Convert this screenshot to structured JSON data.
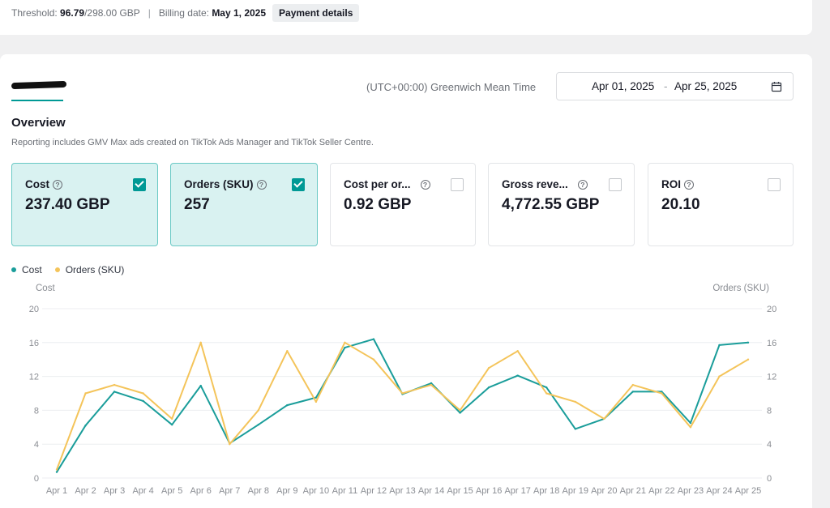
{
  "billing": {
    "threshold_label": "Threshold:",
    "threshold_used": "96.79",
    "threshold_total": "/298.00 GBP",
    "separator": "|",
    "billing_date_label": "Billing date:",
    "billing_date": "May 1, 2025",
    "payment_button": "Payment details"
  },
  "header": {
    "timezone": "(UTC+00:00) Greenwich Mean Time",
    "date_start": "Apr 01, 2025",
    "date_sep": "-",
    "date_end": "Apr 25, 2025"
  },
  "overview": {
    "title": "Overview",
    "subtitle": "Reporting includes GMV Max ads created on TikTok Ads Manager and TikTok Seller Centre."
  },
  "metrics": [
    {
      "label": "Cost",
      "value": "237.40 GBP",
      "selected": true
    },
    {
      "label": "Orders (SKU)",
      "value": "257",
      "selected": true
    },
    {
      "label": "Cost per or...",
      "value": "0.92 GBP",
      "selected": false
    },
    {
      "label": "Gross reve...",
      "value": "4,772.55 GBP",
      "selected": false
    },
    {
      "label": "ROI",
      "value": "20.10",
      "selected": false
    }
  ],
  "colors": {
    "accent": "#009995",
    "cost_line": "#1a9d9a",
    "orders_line": "#f4c45a",
    "selected_bg": "#d9f2f1"
  },
  "chart_data": {
    "type": "line",
    "categories": [
      "Apr 1",
      "Apr 2",
      "Apr 3",
      "Apr 4",
      "Apr 5",
      "Apr 6",
      "Apr 7",
      "Apr 8",
      "Apr 9",
      "Apr 10",
      "Apr 11",
      "Apr 12",
      "Apr 13",
      "Apr 14",
      "Apr 15",
      "Apr 16",
      "Apr 17",
      "Apr 18",
      "Apr 19",
      "Apr 20",
      "Apr 21",
      "Apr 22",
      "Apr 23",
      "Apr 24",
      "Apr 25"
    ],
    "series": [
      {
        "name": "Cost",
        "axis": "left",
        "color": "#1a9d9a",
        "values": [
          0.7,
          6.2,
          10.2,
          9.1,
          6.3,
          10.9,
          4.1,
          6.3,
          8.6,
          9.5,
          15.4,
          16.4,
          9.9,
          11.2,
          7.7,
          10.7,
          12.1,
          10.7,
          5.8,
          7.0,
          10.2,
          10.2,
          6.5,
          15.7,
          16.0
        ]
      },
      {
        "name": "Orders (SKU)",
        "axis": "right",
        "color": "#f4c45a",
        "values": [
          1,
          10,
          11,
          10,
          7,
          16,
          4,
          8,
          15,
          9,
          16,
          14,
          10,
          11,
          8,
          13,
          15,
          10,
          9,
          7,
          11,
          10,
          6,
          12,
          14
        ]
      }
    ],
    "ylabel_left": "Cost",
    "ylabel_right": "Orders (SKU)",
    "ylim": [
      0,
      20
    ],
    "yticks": [
      0,
      4,
      8,
      12,
      16,
      20
    ],
    "grid": true,
    "legend_position": "top-left"
  }
}
